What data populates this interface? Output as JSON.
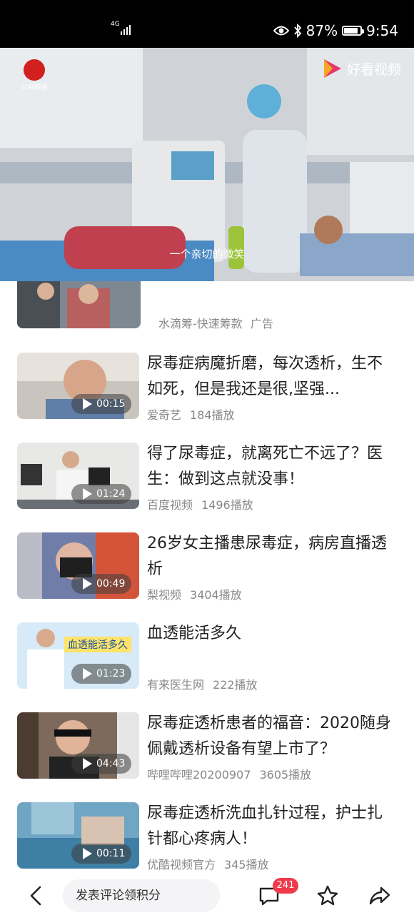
{
  "status": {
    "network": "4G",
    "battery": "87%",
    "time": "9:54",
    "battery_level": 0.87
  },
  "video": {
    "channel_label": "公共频道",
    "brand": "好看视频",
    "subtitle": "一个亲切的微笑"
  },
  "ad": {
    "source": "水滴筹-快速筹款",
    "tag": "广告"
  },
  "items": [
    {
      "title": "尿毒症病魔折磨，每次透析，生不如死，但是我还是很,坚强...",
      "source": "爱奇艺",
      "plays": "184播放",
      "duration": "00:15"
    },
    {
      "title": "得了尿毒症，就离死亡不远了？医生：做到这点就没事！",
      "source": "百度视频",
      "plays": "1496播放",
      "duration": "01:24"
    },
    {
      "title": "26岁女主播患尿毒症，病房直播透析",
      "source": "梨视频",
      "plays": "3404播放",
      "duration": "00:49"
    },
    {
      "title": "血透能活多久",
      "source": "有来医生网",
      "plays": "222播放",
      "duration": "01:23",
      "thumb_text": "血透能活多久"
    },
    {
      "title": "尿毒症透析患者的福音：2020随身佩戴透析设备有望上市了？",
      "source": "哔哩哔哩20200907",
      "plays": "3605播放",
      "duration": "04:43"
    },
    {
      "title": "尿毒症透析洗血扎针过程，护士扎针都心疼病人！",
      "source": "优酷视频官方",
      "plays": "345播放",
      "duration": "00:11"
    }
  ],
  "bottom": {
    "comment_placeholder": "发表评论领积分",
    "comment_count": "241"
  }
}
